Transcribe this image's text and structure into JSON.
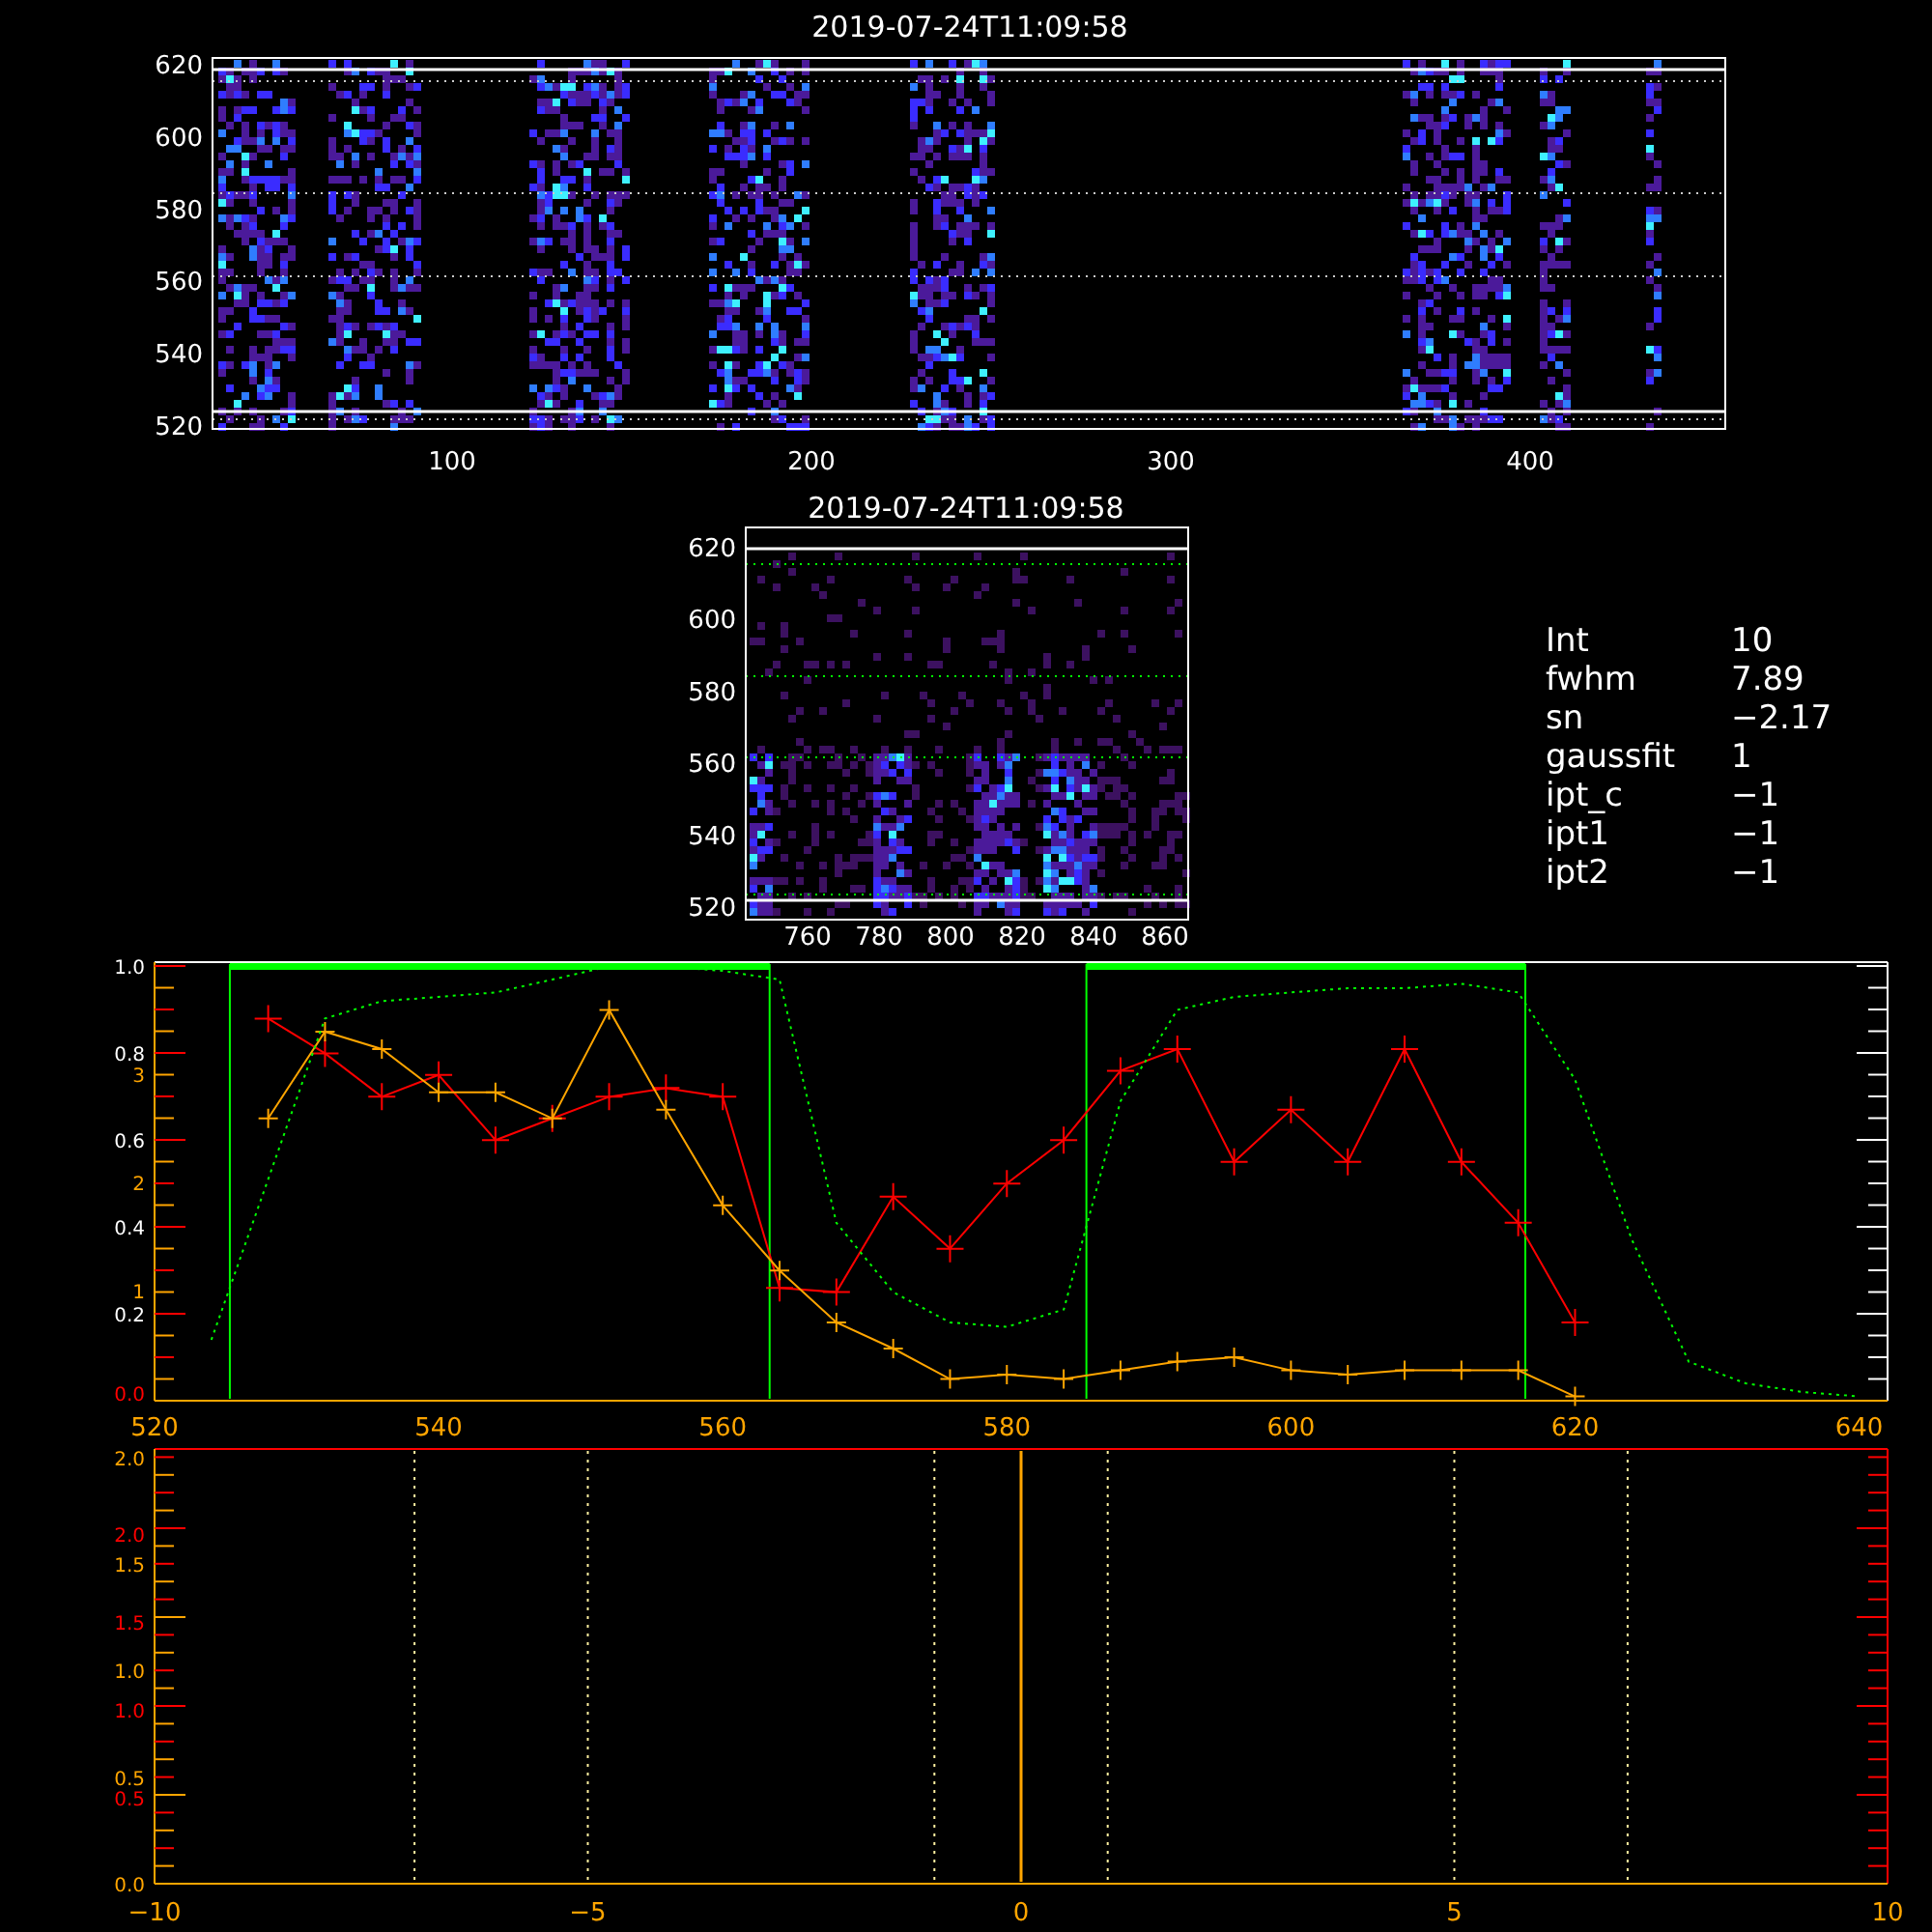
{
  "top_image": {
    "title": "2019-07-24T11:09:58",
    "yticks": [
      "620",
      "600",
      "580",
      "560",
      "540",
      "520"
    ],
    "xticks": [
      "100",
      "200",
      "300",
      "400"
    ]
  },
  "detail_image": {
    "title": "2019-07-24T11:09:58",
    "yticks": [
      "620",
      "600",
      "580",
      "560",
      "540",
      "520"
    ],
    "xticks": [
      "760",
      "780",
      "800",
      "820",
      "840",
      "860"
    ]
  },
  "fit_info": [
    {
      "label": "Int",
      "value": "10"
    },
    {
      "label": "fwhm",
      "value": "7.89"
    },
    {
      "label": "sn",
      "value": "−2.17"
    },
    {
      "label": "gaussfit",
      "value": "1"
    },
    {
      "label": "ipt_c",
      "value": "−1"
    },
    {
      "label": "ipt1",
      "value": "−1"
    },
    {
      "label": "ipt2",
      "value": "−1"
    }
  ],
  "profile_plot": {
    "chart_data": {
      "type": "line",
      "xlim": [
        520,
        642
      ],
      "ylim": [
        0,
        1.01
      ],
      "xticks": [
        520,
        540,
        560,
        580,
        600,
        620,
        640
      ],
      "yticks": [
        {
          "value": 0.2,
          "label": "0.2"
        },
        {
          "value": 0.4,
          "label": "0.4"
        },
        {
          "value": 0.6,
          "label": "0.6"
        },
        {
          "value": 0.8,
          "label": "0.8"
        },
        {
          "value": 1.0,
          "label": "1.0"
        }
      ],
      "x": [
        524,
        528,
        532,
        536,
        540,
        544,
        548,
        552,
        556,
        560,
        564,
        568,
        572,
        576,
        580,
        584,
        588,
        592,
        596,
        600,
        604,
        608,
        612,
        616,
        620,
        624,
        628,
        632,
        636,
        640
      ],
      "series": [
        {
          "color": "#ff0000",
          "marker": "+",
          "values": [
            null,
            0.88,
            0.8,
            0.7,
            0.75,
            0.6,
            0.65,
            0.7,
            0.72,
            0.7,
            0.26,
            0.25,
            0.47,
            0.35,
            0.5,
            0.6,
            0.76,
            0.81,
            0.55,
            0.67,
            0.55,
            0.81,
            0.55,
            0.41,
            0.18,
            null,
            null,
            null,
            null,
            null
          ]
        },
        {
          "color": "#ffa500",
          "marker": "+",
          "values": [
            null,
            0.65,
            0.85,
            0.81,
            0.71,
            0.71,
            0.65,
            0.9,
            0.67,
            0.45,
            0.3,
            0.18,
            0.12,
            0.05,
            0.06,
            0.05,
            0.07,
            0.09,
            0.1,
            0.07,
            0.06,
            0.07,
            0.07,
            0.07,
            0.01,
            null,
            null,
            null,
            null,
            null
          ]
        },
        {
          "color": "#00ff00",
          "line_style": "dotted",
          "values": [
            0.14,
            0.51,
            0.88,
            0.92,
            0.93,
            0.94,
            0.97,
            1.0,
            1.0,
            0.99,
            0.97,
            0.41,
            0.25,
            0.18,
            0.17,
            0.21,
            0.69,
            0.9,
            0.93,
            0.94,
            0.95,
            0.95,
            0.96,
            0.94,
            0.74,
            0.37,
            0.09,
            0.04,
            0.02,
            0.01
          ]
        }
      ],
      "ref_lines": [
        {
          "axis": "x",
          "value": 525.3,
          "color": "#00ff00"
        },
        {
          "axis": "x",
          "value": 563.3,
          "color": "#00ff00"
        },
        {
          "axis": "x",
          "value": 585.6,
          "color": "#00ff00"
        },
        {
          "axis": "x",
          "value": 616.5,
          "color": "#00ff00"
        }
      ]
    },
    "extra_axes": [
      {
        "color": "#ffa500",
        "labels": [
          "3",
          "2",
          "1"
        ]
      },
      {
        "color": "#ff0000",
        "labels": [
          "0.0"
        ]
      }
    ]
  },
  "offset_plot": {
    "chart_data": {
      "type": "line",
      "xlim": [
        -10,
        10
      ],
      "ylim": [
        0,
        2.04
      ],
      "xticks": [
        {
          "value": -10,
          "label": "−10"
        },
        {
          "value": -5,
          "label": "−5"
        },
        0,
        5,
        10
      ],
      "yticks": [
        {
          "value": 0,
          "label": "0.0"
        },
        {
          "value": 0.5,
          "label": "0.5"
        },
        {
          "value": 1.0,
          "label": "1.0"
        },
        {
          "value": 1.5,
          "label": "1.5"
        },
        {
          "value": 2.0,
          "label": "2.0"
        }
      ],
      "ref_lines": [
        {
          "axis": "x",
          "value": -7,
          "color": "#fff0a0",
          "line_style": "dotted"
        },
        {
          "axis": "x",
          "value": -5,
          "color": "#fff0a0",
          "line_style": "dotted"
        },
        {
          "axis": "x",
          "value": -1,
          "color": "#fff0a0",
          "line_style": "dotted"
        },
        {
          "axis": "x",
          "value": 0,
          "color": "#ffa500",
          "line_style": "solid"
        },
        {
          "axis": "x",
          "value": 1,
          "color": "#fff0a0",
          "line_style": "dotted"
        },
        {
          "axis": "x",
          "value": 5,
          "color": "#fff0a0",
          "line_style": "dotted"
        },
        {
          "axis": "x",
          "value": 7,
          "color": "#fff0a0",
          "line_style": "dotted"
        }
      ]
    },
    "extra_axes": [
      {
        "color": "#ff0000",
        "labels": [
          "2.0",
          "1.5",
          "1.0",
          "0.5"
        ]
      }
    ]
  }
}
